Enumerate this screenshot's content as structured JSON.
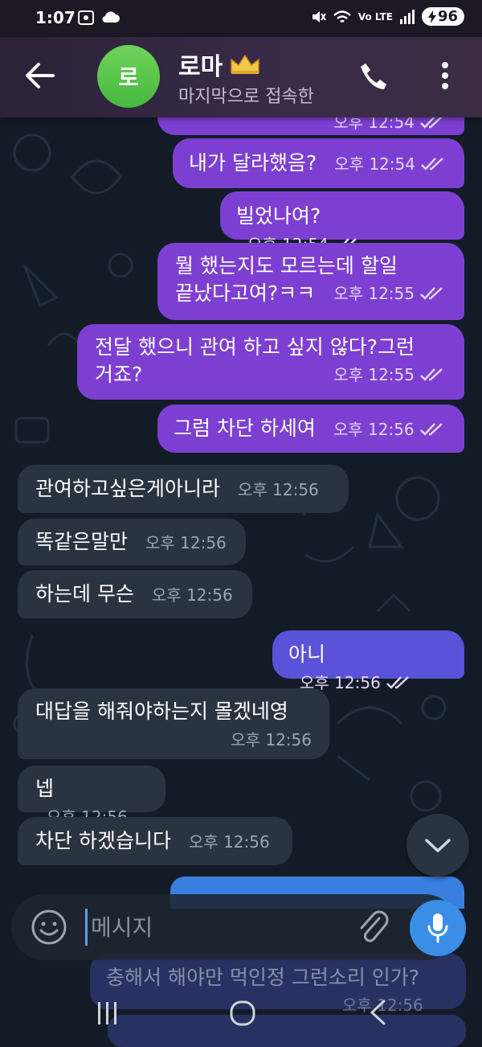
{
  "status_bar": {
    "time": "1:07",
    "battery": "96",
    "network": "Vo LTE"
  },
  "header": {
    "avatar_letter": "로",
    "contact_name": "로마",
    "status_text": "마지막으로 접속한"
  },
  "messages": [
    {
      "dir": "out",
      "text": "",
      "time": "오후 12:54",
      "partial": true
    },
    {
      "dir": "out",
      "text": "내가 달라했음?",
      "time": "오후 12:54"
    },
    {
      "dir": "out",
      "text": "빌었나여?",
      "time": "오후 12:54"
    },
    {
      "dir": "out",
      "text": "뭘 했는지도 모르는데 할일",
      "text2": "끝났다고여?ㅋㅋ",
      "time": "오후 12:55"
    },
    {
      "dir": "out",
      "text": "전달 했으니 관여 하고 싶지 않다?그런",
      "text2": "거죠?",
      "time": "오후 12:55"
    },
    {
      "dir": "out",
      "text": "그럼 차단 하세여",
      "time": "오후 12:56"
    },
    {
      "dir": "in",
      "text": "관여하고싶은게아니라",
      "time": "오후 12:56"
    },
    {
      "dir": "in",
      "text": "똑같은말만",
      "time": "오후 12:56"
    },
    {
      "dir": "in",
      "text": "하는데 무슨",
      "time": "오후 12:56"
    },
    {
      "dir": "out",
      "text": "아니",
      "time": "오후 12:56"
    },
    {
      "dir": "in",
      "text": "대답을 해줘야하는지 몰겠네영",
      "time": "오후 12:56"
    },
    {
      "dir": "in",
      "text": "넵",
      "time": "오후 12:56"
    },
    {
      "dir": "in",
      "text": "차단 하겠습니다",
      "time": "오후 12:56"
    },
    {
      "dir": "out",
      "text": "충해서 해야만 먹인정 그런소리 인가?",
      "time": "오후 12:56",
      "partial": true
    }
  ],
  "composer": {
    "placeholder": "메시지"
  },
  "colors": {
    "outgoing": "#7d3fd1",
    "outgoing_alt": "#5a52d8",
    "incoming": "#2a3440",
    "accent": "#3a8ee6",
    "avatar": "#46b83f"
  }
}
